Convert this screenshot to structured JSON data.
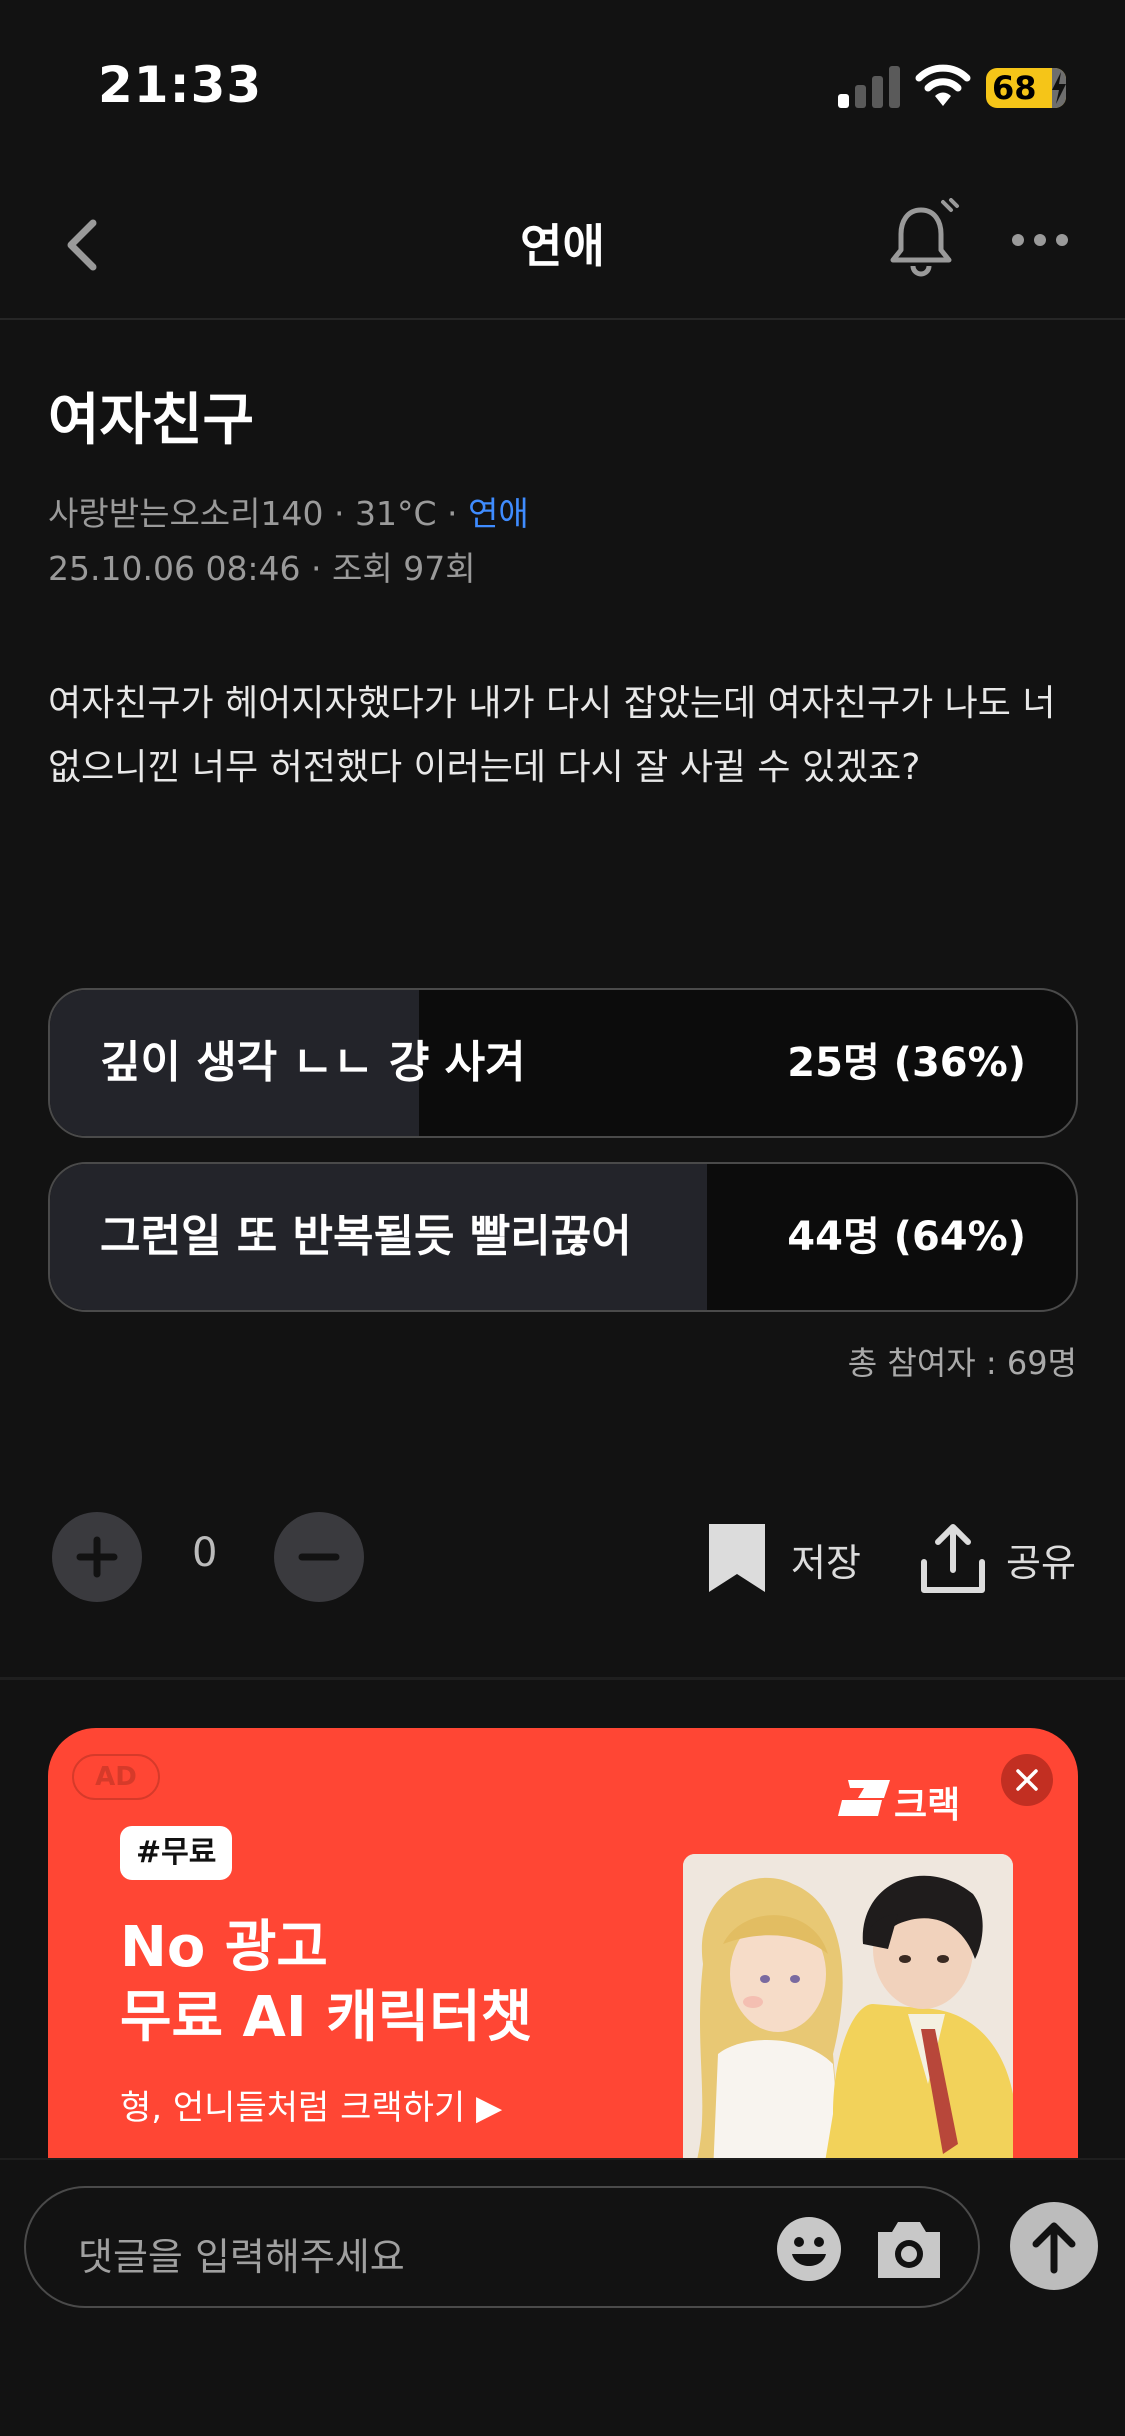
{
  "status_bar": {
    "time": "21:33",
    "battery": "68"
  },
  "nav": {
    "title": "연애"
  },
  "post": {
    "title": "여자친구",
    "author": "사랑받는오소리140",
    "temperature": "31°C",
    "board": "연애",
    "datetime": "25.10.06 08:46",
    "views": "조회 97회",
    "body": "여자친구가 헤어지자했다가 내가 다시 잡았는데 여자친구가 나도 너 없으니낀 너무 허전했다 이러는데 다시 잘 사귈 수 있겠죠?"
  },
  "poll": {
    "options": [
      {
        "label": "깊이 생각 ㄴㄴ 걍 사겨",
        "result": "25명 (36%)",
        "percent": 36
      },
      {
        "label": "그런일 또 반복될듯 빨리끊어",
        "result": "44명 (64%)",
        "percent": 64
      }
    ],
    "total": "총 참여자 : 69명"
  },
  "actions": {
    "vote_count": "0",
    "save_label": "저장",
    "share_label": "공유"
  },
  "ad": {
    "badge": "AD",
    "brand": "크랙",
    "tag": "#무료",
    "headline_line1": "No 광고",
    "headline_line2": "무료 AI 캐릭터챗",
    "subtext": "형, 언니들처럼 크랙하기 ▶",
    "background_color": "#ff4634"
  },
  "comment": {
    "placeholder": "댓글을 입력해주세요"
  },
  "icons": [
    "signal-icon",
    "wifi-icon",
    "battery-icon",
    "back-icon",
    "bell-icon",
    "more-icon",
    "plus-icon",
    "minus-icon",
    "bookmark-icon",
    "share-icon",
    "close-icon",
    "emoji-icon",
    "camera-icon",
    "send-arrow-icon"
  ]
}
